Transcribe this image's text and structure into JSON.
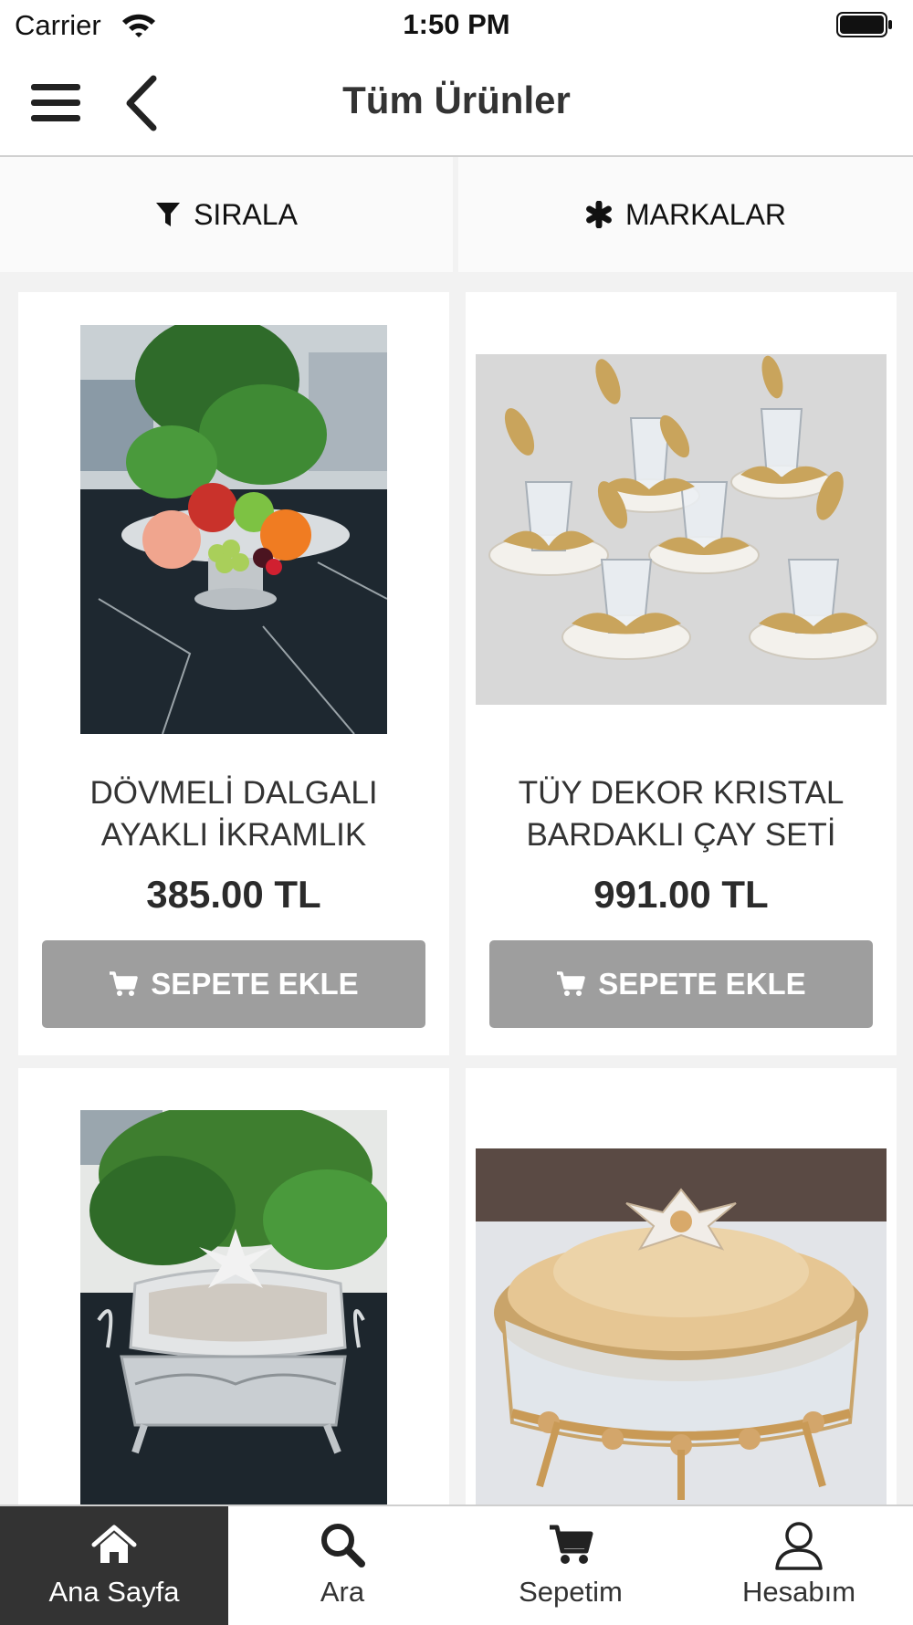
{
  "status_bar": {
    "carrier": "Carrier",
    "time": "1:50 PM"
  },
  "header": {
    "title": "Tüm Ürünler"
  },
  "filters": {
    "sort_label": "SIRALA",
    "brands_label": "MARKALAR"
  },
  "products": [
    {
      "name_line1": "DÖVMELİ DALGALI",
      "name_line2": "AYAKLI İKRAMLIK",
      "price": "385.00 TL",
      "button": "SEPETE EKLE"
    },
    {
      "name_line1": "TÜY DEKOR KRISTAL",
      "name_line2": "BARDAKLI ÇAY SETİ",
      "price": "991.00 TL",
      "button": "SEPETE EKLE"
    },
    {
      "name_line1": "",
      "name_line2": "",
      "price": "",
      "button": ""
    },
    {
      "name_line1": "",
      "name_line2": "",
      "price": "",
      "button": ""
    }
  ],
  "tabs": [
    {
      "label": "Ana Sayfa",
      "icon": "home-icon",
      "active": true
    },
    {
      "label": "Ara",
      "icon": "search-icon",
      "active": false
    },
    {
      "label": "Sepetim",
      "icon": "cart-icon",
      "active": false
    },
    {
      "label": "Hesabım",
      "icon": "user-icon",
      "active": false
    }
  ],
  "colors": {
    "active_tab": "#333333",
    "add_button": "#9e9e9e",
    "filter_bg": "#fafafa",
    "grid_bg": "#f2f2f2"
  }
}
